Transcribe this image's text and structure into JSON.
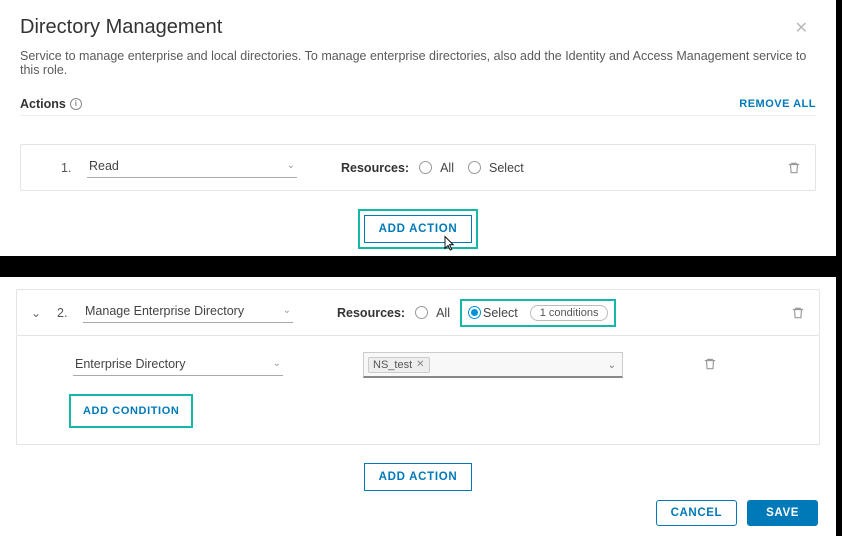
{
  "header": {
    "title": "Directory Management",
    "subtitle": "Service to manage enterprise and local directories. To manage enterprise directories, also add the Identity and Access Management service to this role."
  },
  "actionsBar": {
    "label": "Actions",
    "removeAll": "REMOVE ALL"
  },
  "resourcesLabel": "Resources:",
  "radio": {
    "all": "All",
    "select": "Select"
  },
  "actions": [
    {
      "index": "1.",
      "name": "Read",
      "resources": "all"
    },
    {
      "index": "2.",
      "name": "Manage Enterprise Directory",
      "resources": "select",
      "conditionsPill": "1 conditions",
      "conditionType": "Enterprise Directory",
      "conditionValues": [
        "NS_test"
      ]
    }
  ],
  "buttons": {
    "addAction": "ADD ACTION",
    "addCondition": "ADD CONDITION",
    "cancel": "CANCEL",
    "save": "SAVE"
  }
}
